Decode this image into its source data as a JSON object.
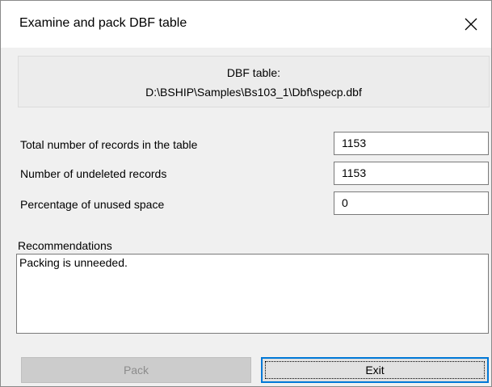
{
  "window": {
    "title": "Examine and pack DBF table"
  },
  "info": {
    "line1": "DBF table:",
    "line2": "D:\\BSHIP\\Samples\\Bs103_1\\Dbf\\specp.dbf"
  },
  "fields": [
    {
      "label": "Total number of records in the table",
      "value": "1153"
    },
    {
      "label": "Number of undeleted records",
      "value": "1153"
    },
    {
      "label": "Percentage of unused space",
      "value": "0"
    }
  ],
  "recommendations": {
    "label": "Recommendations",
    "text": "Packing is unneeded."
  },
  "buttons": {
    "pack": "Pack",
    "exit": "Exit"
  }
}
